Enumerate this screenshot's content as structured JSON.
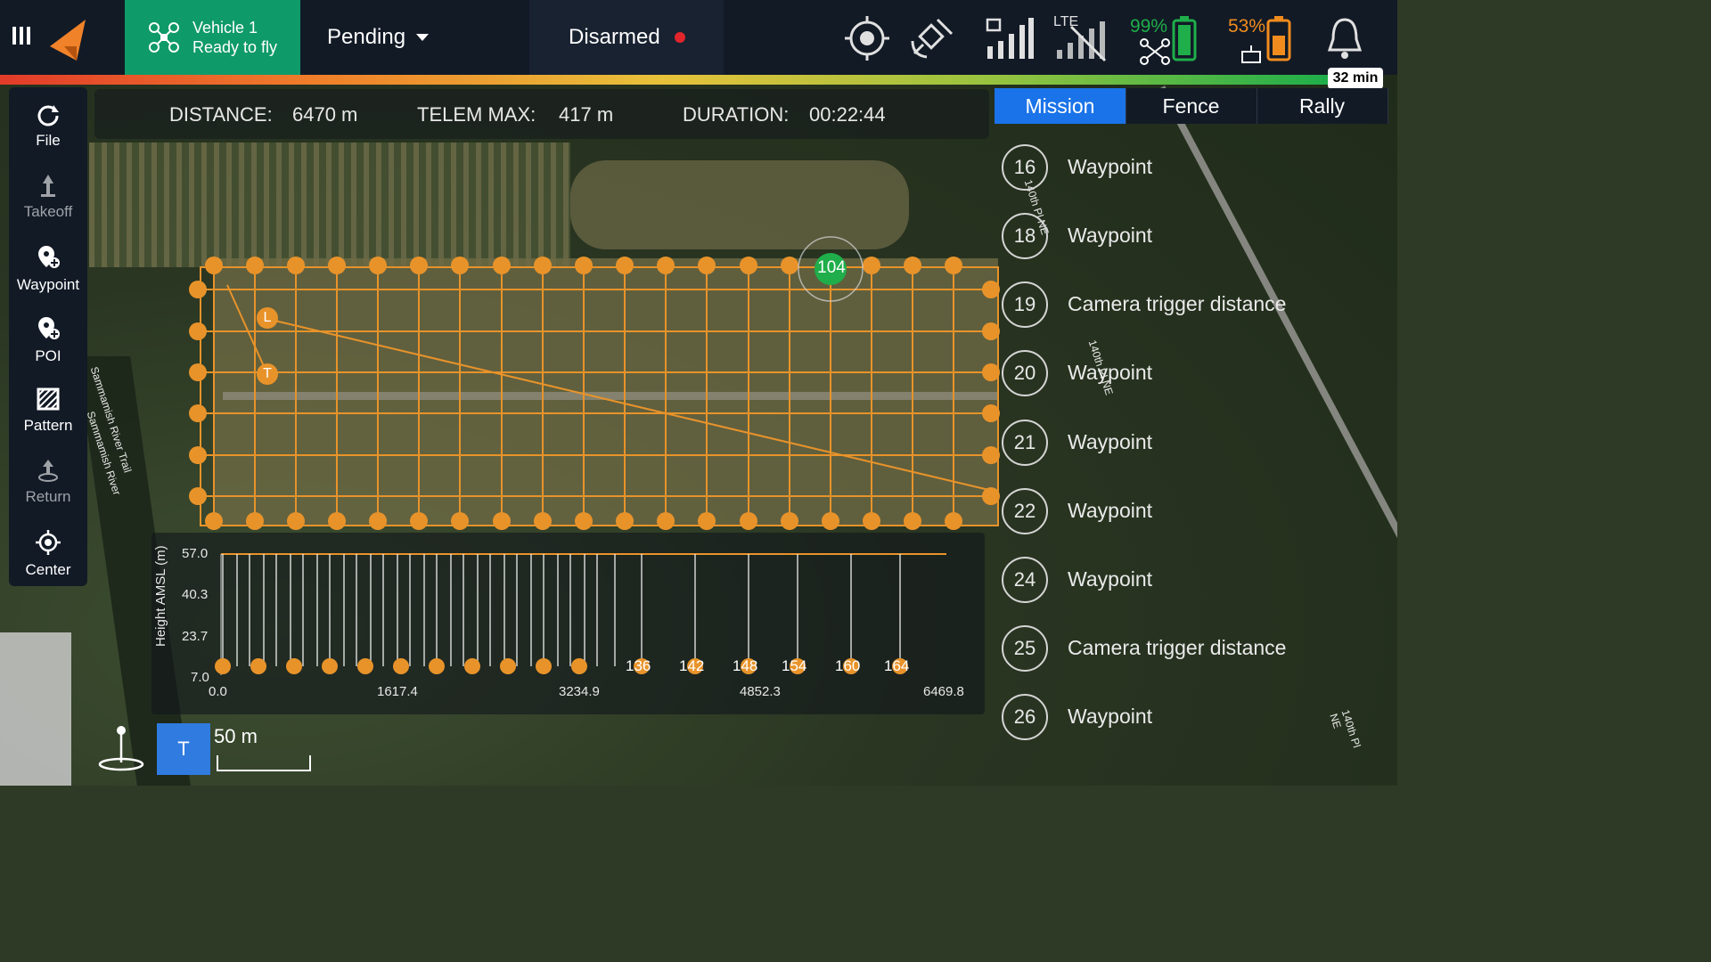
{
  "vehicle": {
    "name": "Vehicle 1",
    "status": "Ready to fly"
  },
  "flight_mode": "Pending",
  "arm_state": "Disarmed",
  "signal": {
    "network": "LTE"
  },
  "battery": {
    "drone_pct": "99%",
    "controller_pct": "53%",
    "flight_time": "32 min",
    "colors": {
      "drone": "#1fae4a",
      "controller": "#f08c1e"
    }
  },
  "toolbar": {
    "file": "File",
    "takeoff": "Takeoff",
    "waypoint": "Waypoint",
    "poi": "POI",
    "pattern": "Pattern",
    "return": "Return",
    "center": "Center"
  },
  "stats": {
    "distance_label": "DISTANCE:",
    "distance_value": "6470 m",
    "telem_label": "TELEM MAX:",
    "telem_value": "417 m",
    "duration_label": "DURATION:",
    "duration_value": "00:22:44"
  },
  "tabs": [
    "Mission",
    "Fence",
    "Rally"
  ],
  "mission_items": [
    {
      "num": "16",
      "label": "Waypoint"
    },
    {
      "num": "18",
      "label": "Waypoint"
    },
    {
      "num": "19",
      "label": "Camera trigger distance"
    },
    {
      "num": "20",
      "label": "Waypoint"
    },
    {
      "num": "21",
      "label": "Waypoint"
    },
    {
      "num": "22",
      "label": "Waypoint"
    },
    {
      "num": "24",
      "label": "Waypoint"
    },
    {
      "num": "25",
      "label": "Camera trigger distance"
    },
    {
      "num": "26",
      "label": "Waypoint"
    }
  ],
  "map": {
    "current_waypoint": "104",
    "launch_marker": "L",
    "takeoff_marker": "T",
    "labels": [
      "Sammamish River Trail",
      "Sammamish River",
      "140th Pl NE",
      "140th Pl NE",
      "140th Pl NE"
    ],
    "scale": "50 m",
    "corner_marker": "T"
  },
  "elevation": {
    "ylabel": "Height AMSL (m)",
    "yticks": [
      "57.0",
      "40.3",
      "23.7",
      "7.0"
    ],
    "xticks": [
      "0.0",
      "1617.4",
      "3234.9",
      "4852.3",
      "6469.8"
    ],
    "marker_labels": [
      "136",
      "142",
      "148",
      "154",
      "160",
      "164"
    ]
  }
}
